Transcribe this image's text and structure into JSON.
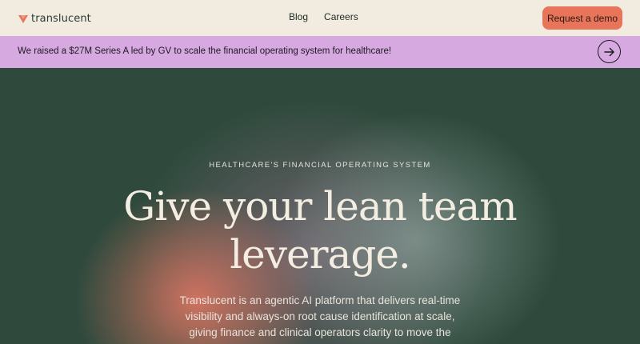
{
  "nav": {
    "brand": "translucent",
    "links": [
      "Blog",
      "Careers"
    ],
    "cta": "Request a demo"
  },
  "announcement": {
    "text": "We raised a $27M Series A led by GV to scale the financial operating system for healthcare!"
  },
  "hero": {
    "eyebrow": "HEALTHCARE'S FINANCIAL OPERATING SYSTEM",
    "headline_line1": "Give your lean team",
    "headline_line2": "leverage.",
    "subtext": "Translucent is an agentic AI platform that delivers real-time visibility and always-on root cause identification at scale, giving finance and clinical operators clarity to move the margin."
  },
  "colors": {
    "nav_bg": "#f2ece0",
    "cta_bg": "#e8745a",
    "banner_bg": "#d6a9e0",
    "hero_bg": "#2f4a3d"
  },
  "icons": {
    "logo": "translucent-logo-mark",
    "banner_arrow": "arrow-right-icon"
  }
}
